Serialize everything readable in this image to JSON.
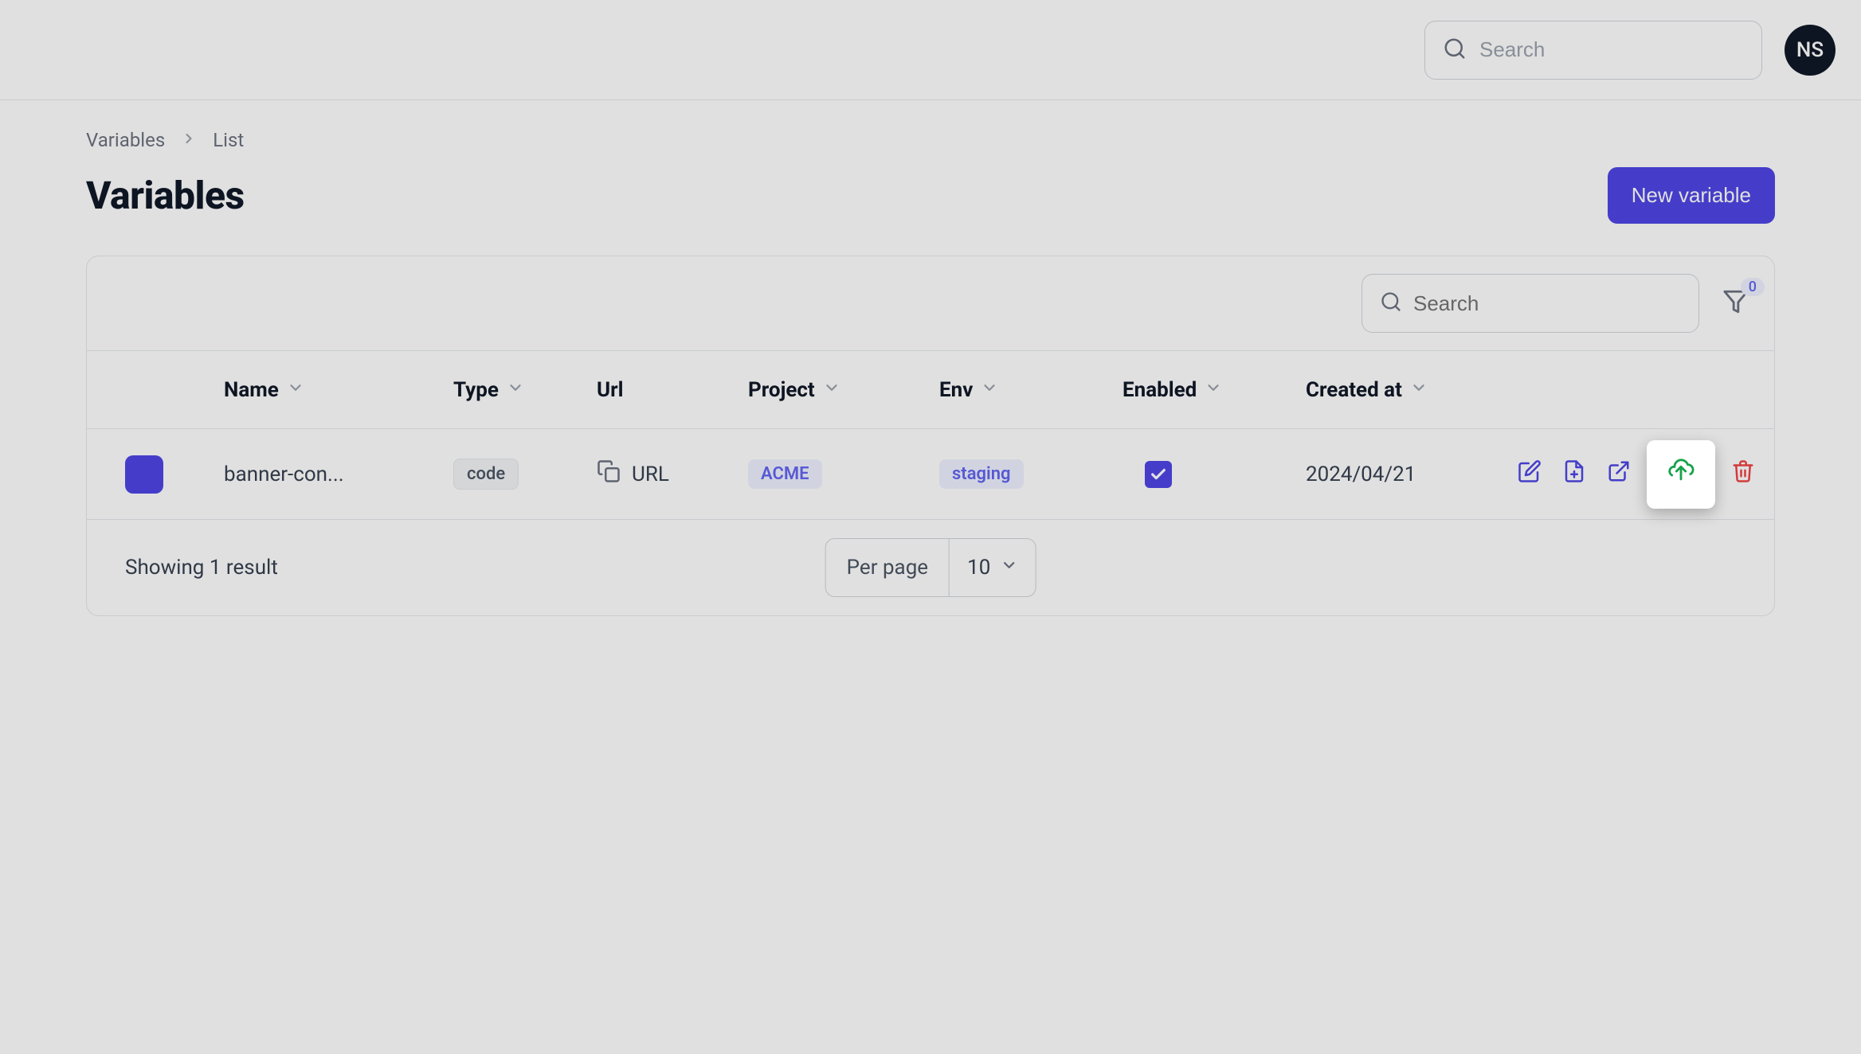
{
  "topbar": {
    "search_placeholder": "Search",
    "avatar_initials": "NS"
  },
  "breadcrumb": {
    "root": "Variables",
    "current": "List"
  },
  "header": {
    "title": "Variables",
    "new_button": "New variable"
  },
  "toolbar": {
    "search_placeholder": "Search",
    "filter_count": "0"
  },
  "columns": {
    "name": "Name",
    "type": "Type",
    "url": "Url",
    "project": "Project",
    "env": "Env",
    "enabled": "Enabled",
    "created_at": "Created at"
  },
  "rows": [
    {
      "name": "banner-con...",
      "type_badge": "code",
      "url_label": "URL",
      "project_badge": "ACME",
      "env_badge": "staging",
      "enabled": true,
      "created_at": "2024/04/21"
    }
  ],
  "footer": {
    "summary": "Showing 1 result",
    "per_page_label": "Per page",
    "per_page_value": "10"
  },
  "colors": {
    "accent": "#4f46e5",
    "indigo_soft_bg": "#eef2ff",
    "indigo_soft_fg": "#6366f1",
    "danger": "#ef4444",
    "success": "#16a34a"
  }
}
